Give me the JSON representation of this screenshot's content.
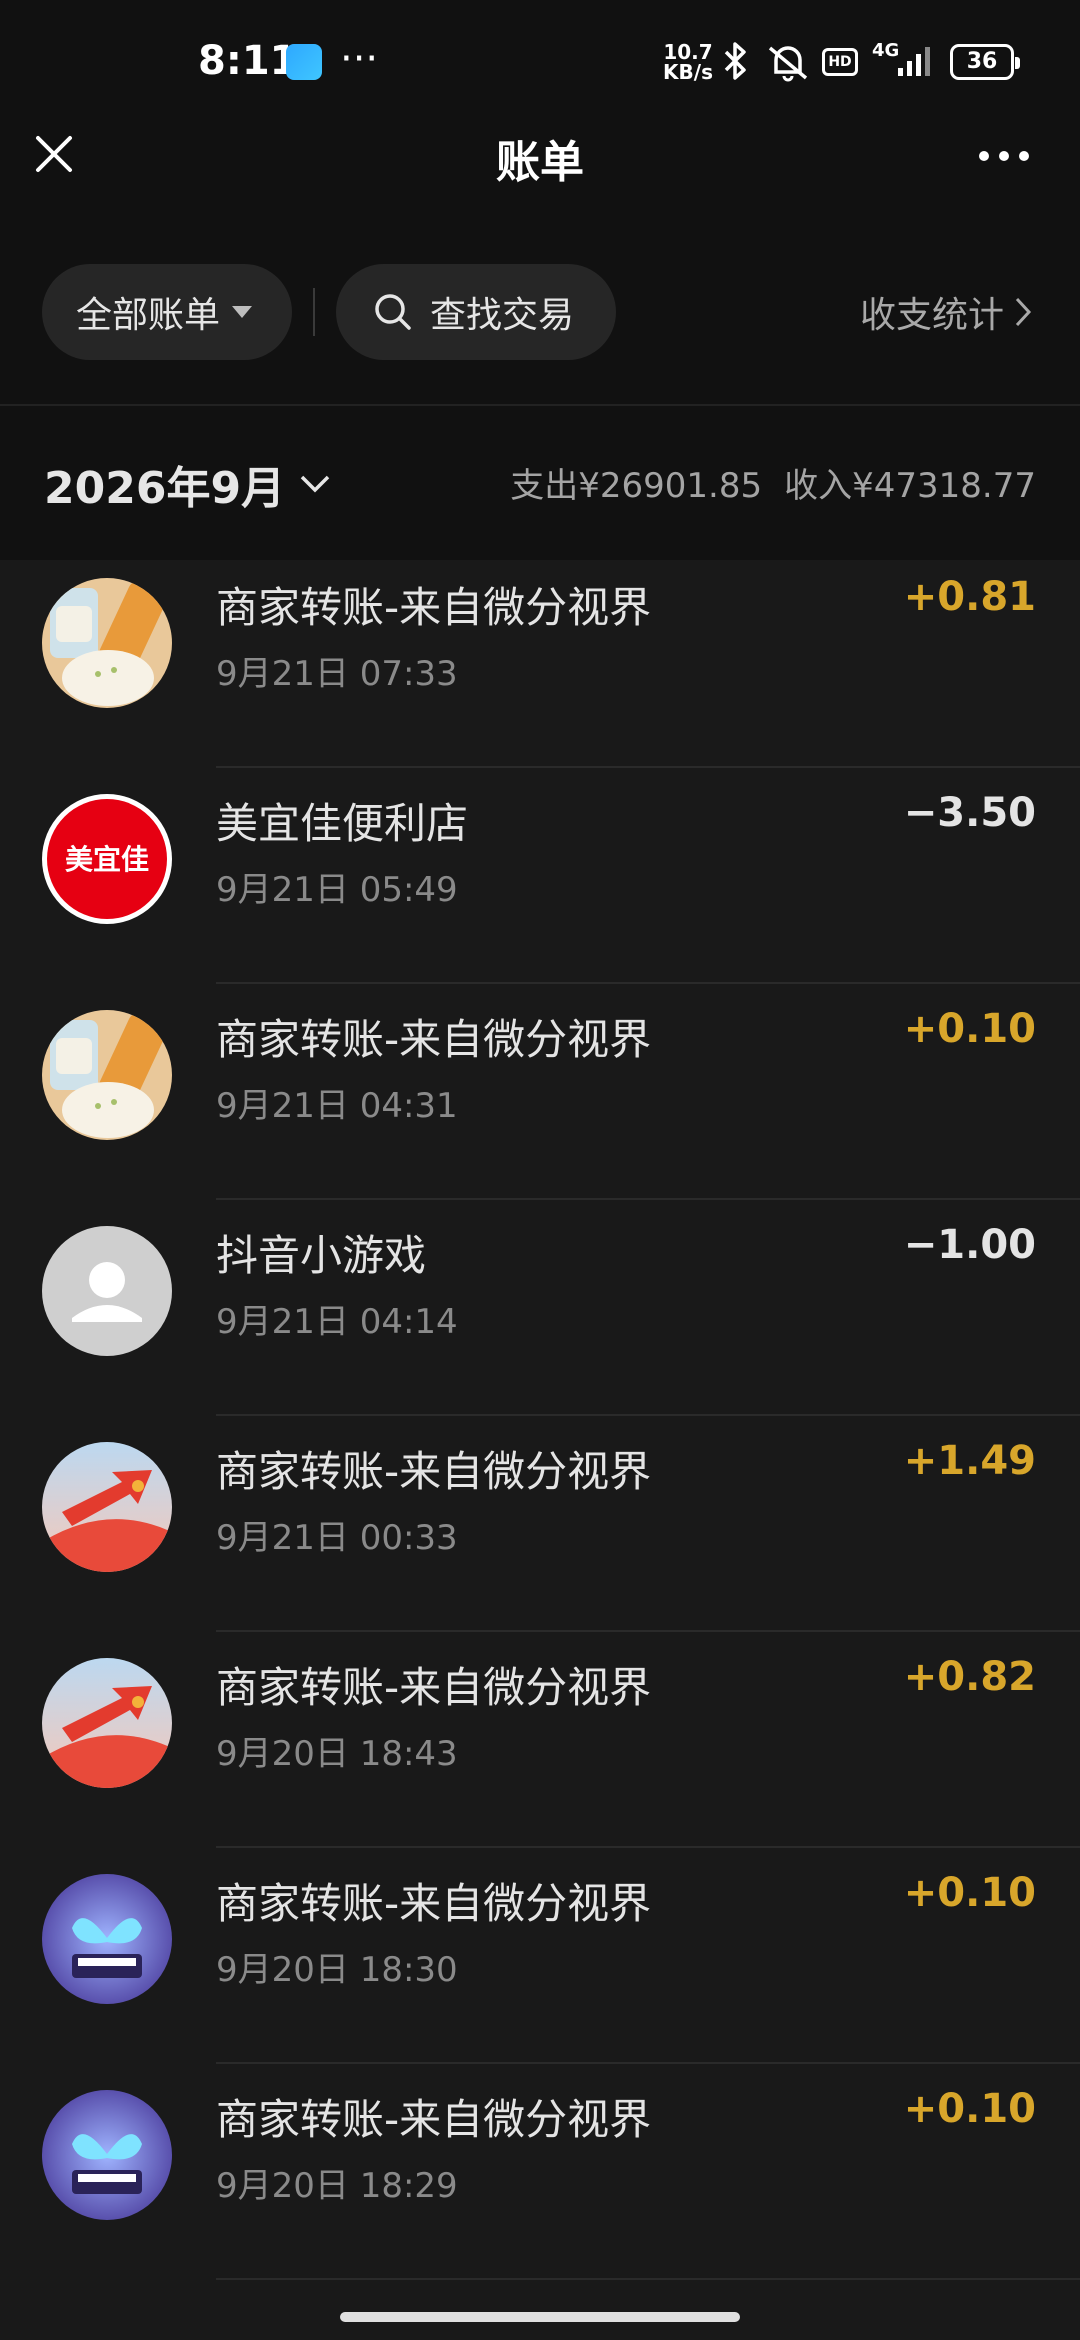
{
  "status_bar": {
    "time": "8:11",
    "dots": "···",
    "speed_value": "10.7",
    "speed_unit": "KB/s",
    "hd": "HD",
    "network": "4G",
    "battery": "36"
  },
  "header": {
    "title": "账单"
  },
  "filters": {
    "all_bills": "全部账单",
    "search": "查找交易",
    "stats": "收支统计"
  },
  "month": {
    "label": "2026年9月",
    "expense": "支出¥26901.85",
    "income": "收入¥47318.77"
  },
  "colors": {
    "income_amount": "#d8a62b",
    "background": "#191919",
    "header_background": "#111111"
  },
  "transactions": [
    {
      "name": "商家转账-来自微分视界",
      "time": "9月21日 07:33",
      "amount": "+0.81",
      "avatar": "breakfast-avatar"
    },
    {
      "name": "美宜佳便利店",
      "time": "9月21日 05:49",
      "amount": "-3.50",
      "avatar": "meiyijia-logo",
      "logo_text": "美宜佳"
    },
    {
      "name": "商家转账-来自微分视界",
      "time": "9月21日 04:31",
      "amount": "+0.10",
      "avatar": "breakfast-avatar"
    },
    {
      "name": "抖音小游戏",
      "time": "9月21日 04:14",
      "amount": "-1.00",
      "avatar": "default-user-avatar"
    },
    {
      "name": "商家转账-来自微分视界",
      "time": "9月21日 00:33",
      "amount": "+1.49",
      "avatar": "red-arrow-avatar"
    },
    {
      "name": "商家转账-来自微分视界",
      "time": "9月20日 18:43",
      "amount": "+0.82",
      "avatar": "red-arrow-avatar"
    },
    {
      "name": "商家转账-来自微分视界",
      "time": "9月20日 18:30",
      "amount": "+0.10",
      "avatar": "butterfly-piano-avatar"
    },
    {
      "name": "商家转账-来自微分视界",
      "time": "9月20日 18:29",
      "amount": "+0.10",
      "avatar": "butterfly-piano-avatar"
    }
  ]
}
